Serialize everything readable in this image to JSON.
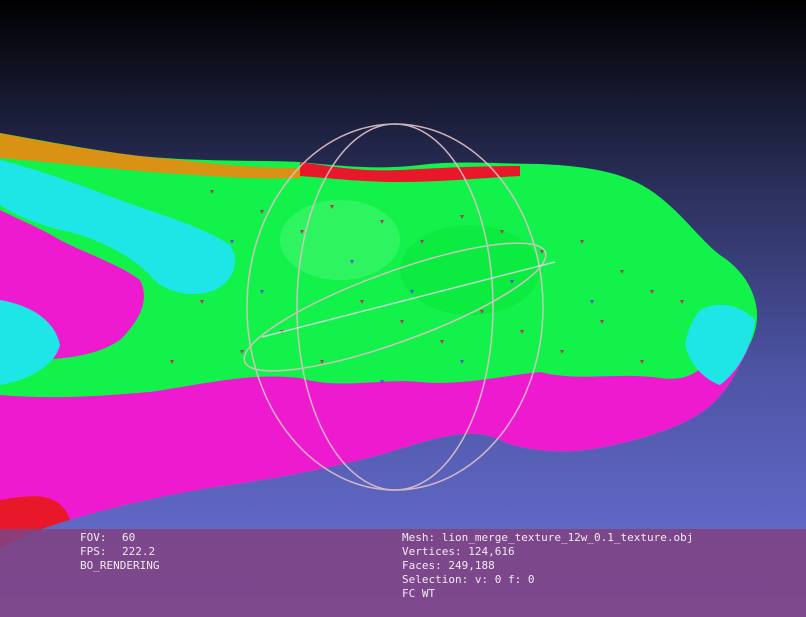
{
  "viewer": {
    "colors": {
      "background_top": "#000000",
      "background_bottom": "#6a72d6",
      "mesh_green": "#13f24a",
      "mesh_magenta": "#ee1ad0",
      "mesh_cyan": "#1fe6e6",
      "mesh_red": "#e8172a",
      "mesh_orange": "#d99214",
      "hud_panel": "#804282"
    },
    "trackball_visible": true
  },
  "hud": {
    "left": {
      "fov_label": "FOV:",
      "fov_value": "60",
      "fps_label": "FPS:",
      "fps_value": "222.2",
      "render_mode": "BO_RENDERING"
    },
    "right": {
      "mesh_line": "Mesh: lion_merge_texture_12w_0.1_texture.obj",
      "vertices_line": "Vertices: 124,616",
      "faces_line": "Faces: 249,188",
      "selection_line": "Selection: v: 0 f: 0",
      "flags_line": "FC WT"
    }
  }
}
